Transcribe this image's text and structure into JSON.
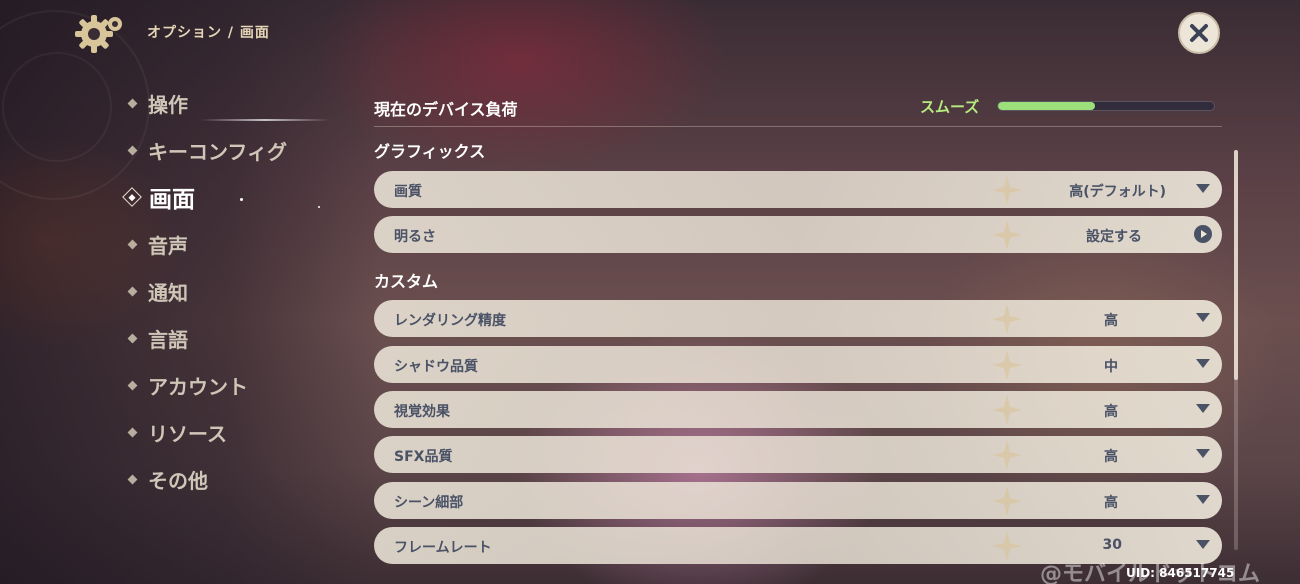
{
  "header": {
    "breadcrumb": "オプション / 画面",
    "settings_icon": "gear-icon",
    "close_icon": "close-icon"
  },
  "sidebar": {
    "items": [
      {
        "label": "操作",
        "active": false
      },
      {
        "label": "キーコンフィグ",
        "active": false
      },
      {
        "label": "画面",
        "active": true
      },
      {
        "label": "音声",
        "active": false
      },
      {
        "label": "通知",
        "active": false
      },
      {
        "label": "言語",
        "active": false
      },
      {
        "label": "アカウント",
        "active": false
      },
      {
        "label": "リソース",
        "active": false
      },
      {
        "label": "その他",
        "active": false
      }
    ]
  },
  "device_load": {
    "label": "現在のデバイス負荷",
    "status": "スムーズ",
    "status_color": "#b7ea7f",
    "level": 0.45
  },
  "graphics": {
    "title": "グラフィックス",
    "rows": [
      {
        "label": "画質",
        "value": "高(デフォルト)",
        "control": "dropdown"
      },
      {
        "label": "明るさ",
        "value": "設定する",
        "control": "link"
      }
    ]
  },
  "custom": {
    "title": "カスタム",
    "rows": [
      {
        "label": "レンダリング精度",
        "value": "高",
        "control": "dropdown"
      },
      {
        "label": "シャドウ品質",
        "value": "中",
        "control": "dropdown"
      },
      {
        "label": "視覚効果",
        "value": "高",
        "control": "dropdown"
      },
      {
        "label": "SFX品質",
        "value": "高",
        "control": "dropdown"
      },
      {
        "label": "シーン細部",
        "value": "高",
        "control": "dropdown"
      },
      {
        "label": "フレームレート",
        "value": "30",
        "control": "dropdown"
      }
    ]
  },
  "footer": {
    "watermark": "@モバイルドットコム",
    "uid": "UID: 846517745"
  },
  "colors": {
    "row_bg": "#ece5d8",
    "row_text": "#4a5266",
    "accent": "#b7ea7f"
  }
}
